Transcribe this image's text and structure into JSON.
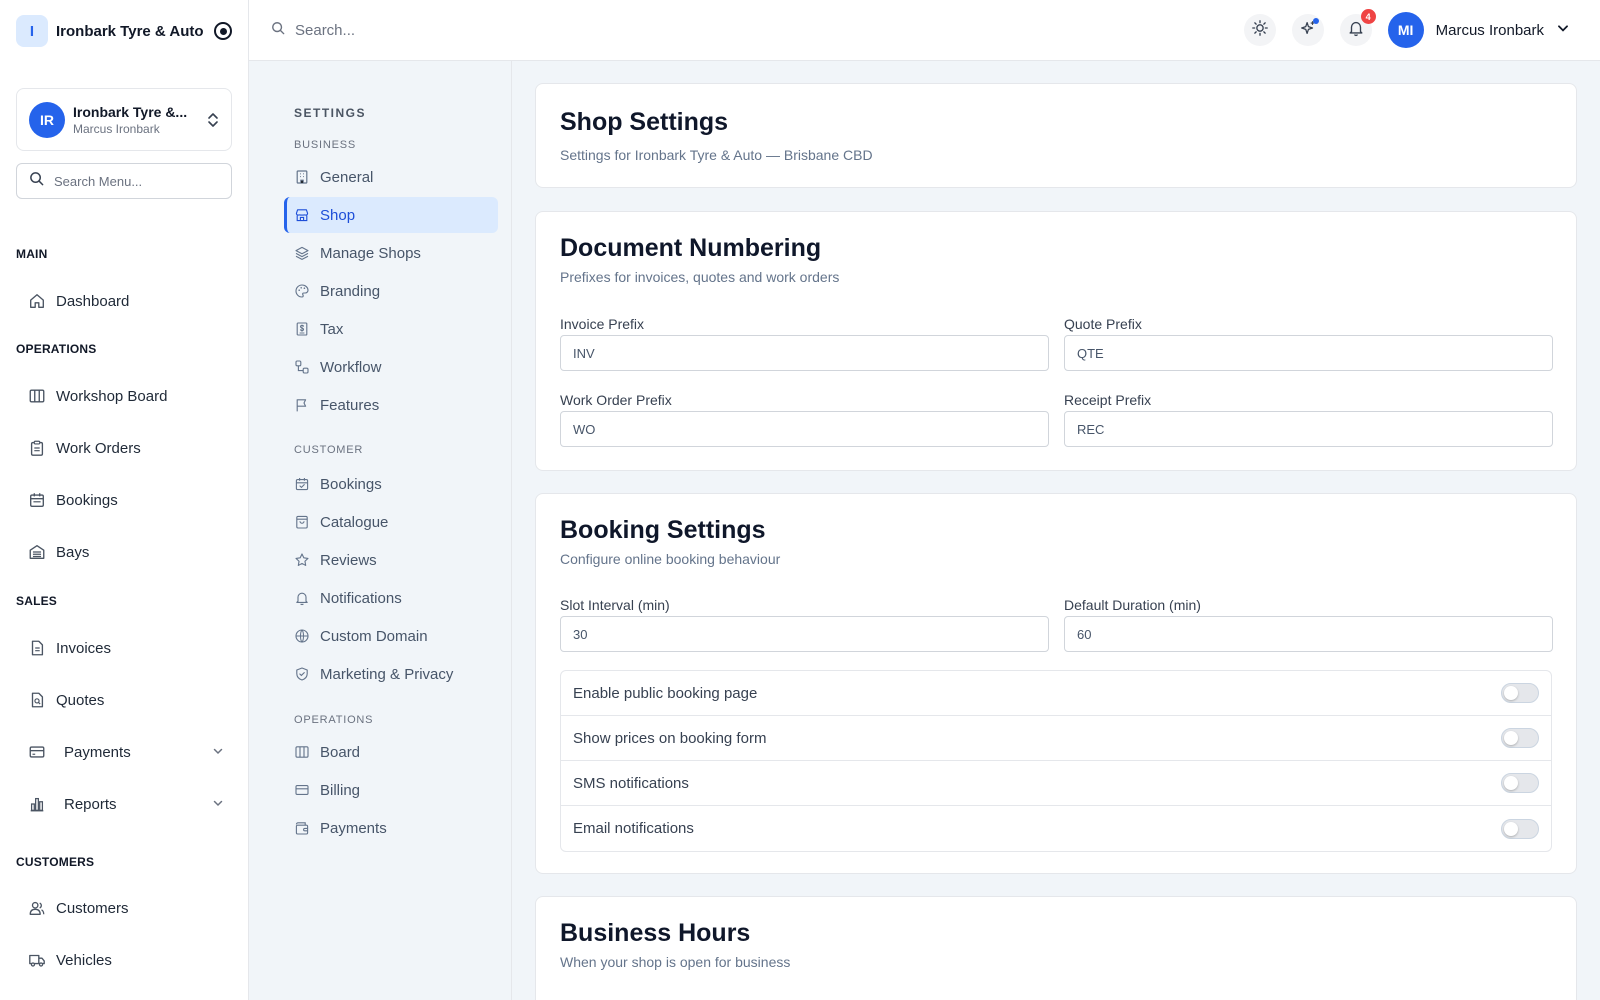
{
  "brand": {
    "logo_letter": "I",
    "name": "Ironbark Tyre & Auto"
  },
  "org": {
    "initials": "IR",
    "name": "Ironbark Tyre &...",
    "user": "Marcus Ironbark"
  },
  "menu_search": {
    "placeholder": "Search Menu..."
  },
  "sidebar": {
    "main": {
      "heading": "MAIN",
      "items": [
        {
          "label": "Dashboard"
        }
      ]
    },
    "operations": {
      "heading": "OPERATIONS",
      "items": [
        {
          "label": "Workshop Board"
        },
        {
          "label": "Work Orders"
        },
        {
          "label": "Bookings"
        },
        {
          "label": "Bays"
        }
      ]
    },
    "sales": {
      "heading": "SALES",
      "items": [
        {
          "label": "Invoices"
        },
        {
          "label": "Quotes"
        },
        {
          "label": "Payments"
        },
        {
          "label": "Reports"
        }
      ]
    },
    "customers": {
      "heading": "CUSTOMERS",
      "items": [
        {
          "label": "Customers"
        },
        {
          "label": "Vehicles"
        }
      ]
    }
  },
  "header": {
    "search_placeholder": "Search...",
    "notification_count": "4",
    "user_initials": "MI",
    "user_name": "Marcus Ironbark"
  },
  "settings_nav": {
    "title": "SETTINGS",
    "business": {
      "heading": "BUSINESS",
      "items": [
        {
          "label": "General"
        },
        {
          "label": "Shop"
        },
        {
          "label": "Manage Shops"
        },
        {
          "label": "Branding"
        },
        {
          "label": "Tax"
        },
        {
          "label": "Workflow"
        },
        {
          "label": "Features"
        }
      ]
    },
    "customer": {
      "heading": "CUSTOMER",
      "items": [
        {
          "label": "Bookings"
        },
        {
          "label": "Catalogue"
        },
        {
          "label": "Reviews"
        },
        {
          "label": "Notifications"
        },
        {
          "label": "Custom Domain"
        },
        {
          "label": "Marketing & Privacy"
        }
      ]
    },
    "operations": {
      "heading": "OPERATIONS",
      "items": [
        {
          "label": "Board"
        },
        {
          "label": "Billing"
        },
        {
          "label": "Payments"
        }
      ]
    }
  },
  "shop_settings": {
    "title": "Shop Settings",
    "subtitle": "Settings for Ironbark Tyre & Auto — Brisbane CBD"
  },
  "document_numbering": {
    "title": "Document Numbering",
    "subtitle": "Prefixes for invoices, quotes and work orders",
    "invoice_prefix": {
      "label": "Invoice Prefix",
      "value": "INV"
    },
    "quote_prefix": {
      "label": "Quote Prefix",
      "value": "QTE"
    },
    "work_order_prefix": {
      "label": "Work Order Prefix",
      "value": "WO"
    },
    "receipt_prefix": {
      "label": "Receipt Prefix",
      "value": "REC"
    }
  },
  "booking_settings": {
    "title": "Booking Settings",
    "subtitle": "Configure online booking behaviour",
    "slot_interval": {
      "label": "Slot Interval (min)",
      "value": "30"
    },
    "default_duration": {
      "label": "Default Duration (min)",
      "value": "60"
    },
    "toggles": [
      {
        "label": "Enable public booking page",
        "on": false
      },
      {
        "label": "Show prices on booking form",
        "on": false
      },
      {
        "label": "SMS notifications",
        "on": false
      },
      {
        "label": "Email notifications",
        "on": false
      }
    ]
  },
  "business_hours": {
    "title": "Business Hours",
    "subtitle": "When your shop is open for business"
  },
  "colors": {
    "accent": "#2563eb",
    "active_bg": "#dbeafe",
    "badge": "#ef4444"
  }
}
